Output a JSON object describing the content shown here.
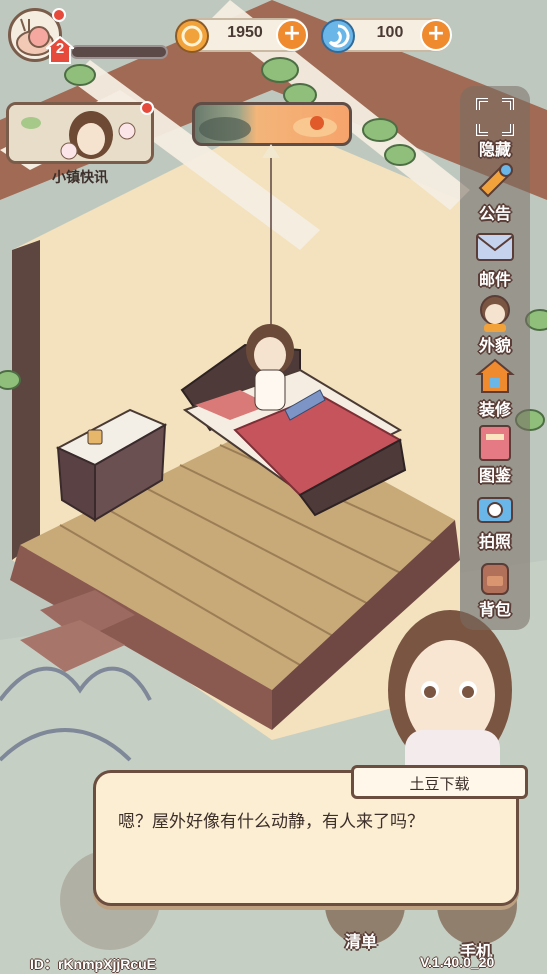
{
  "hud": {
    "level": "2",
    "coins": "1950",
    "gems": "100",
    "news_label": "小镇快讯"
  },
  "side_menu": [
    {
      "label": "隐藏",
      "icon": "hide-icon"
    },
    {
      "label": "公告",
      "icon": "megaphone-icon"
    },
    {
      "label": "邮件",
      "icon": "mail-icon"
    },
    {
      "label": "外貌",
      "icon": "appearance-icon"
    },
    {
      "label": "装修",
      "icon": "decorate-icon"
    },
    {
      "label": "图鉴",
      "icon": "collection-book-icon"
    },
    {
      "label": "拍照",
      "icon": "camera-icon"
    },
    {
      "label": "背包",
      "icon": "backpack-icon"
    }
  ],
  "dialog": {
    "speaker": "土豆下载",
    "text": "嗯？屋外好像有什么动静，有人来了吗？"
  },
  "bottom": {
    "list_label": "清单",
    "phone_label": "手机"
  },
  "footer": {
    "id_text": "ID：rKnmpXjjRcuE",
    "version": "V.1.40.0_20"
  },
  "colors": {
    "accent": "#f08a2f",
    "notification": "#e64a3a",
    "outline": "#6b4e40"
  }
}
